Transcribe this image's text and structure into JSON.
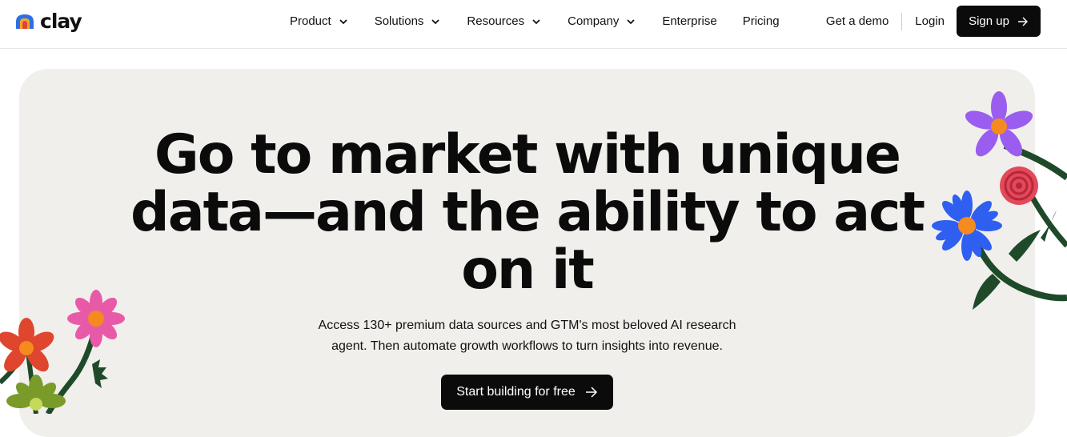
{
  "brand": {
    "name": "clay",
    "colors": {
      "blue": "#2f6fe0",
      "orange": "#f5a623",
      "red": "#e0452d"
    }
  },
  "nav": {
    "items": [
      {
        "label": "Product",
        "has_dropdown": true
      },
      {
        "label": "Solutions",
        "has_dropdown": true
      },
      {
        "label": "Resources",
        "has_dropdown": true
      },
      {
        "label": "Company",
        "has_dropdown": true
      },
      {
        "label": "Enterprise",
        "has_dropdown": false
      },
      {
        "label": "Pricing",
        "has_dropdown": false
      }
    ],
    "get_demo": "Get a demo",
    "login": "Login",
    "signup": "Sign up",
    "signup_icon": "arrow-right-icon"
  },
  "hero": {
    "headline_line1": "Go to market with unique",
    "headline_line2": "data—and the ability to act",
    "headline_line3": "on it",
    "subtext_line1": "Access 130+ premium data sources and GTM's most beloved AI research",
    "subtext_line2": "agent. Then automate growth workflows to turn insights into revenue.",
    "cta_label": "Start building for free",
    "cta_icon": "arrow-right-icon",
    "background": "#f0efeb"
  }
}
